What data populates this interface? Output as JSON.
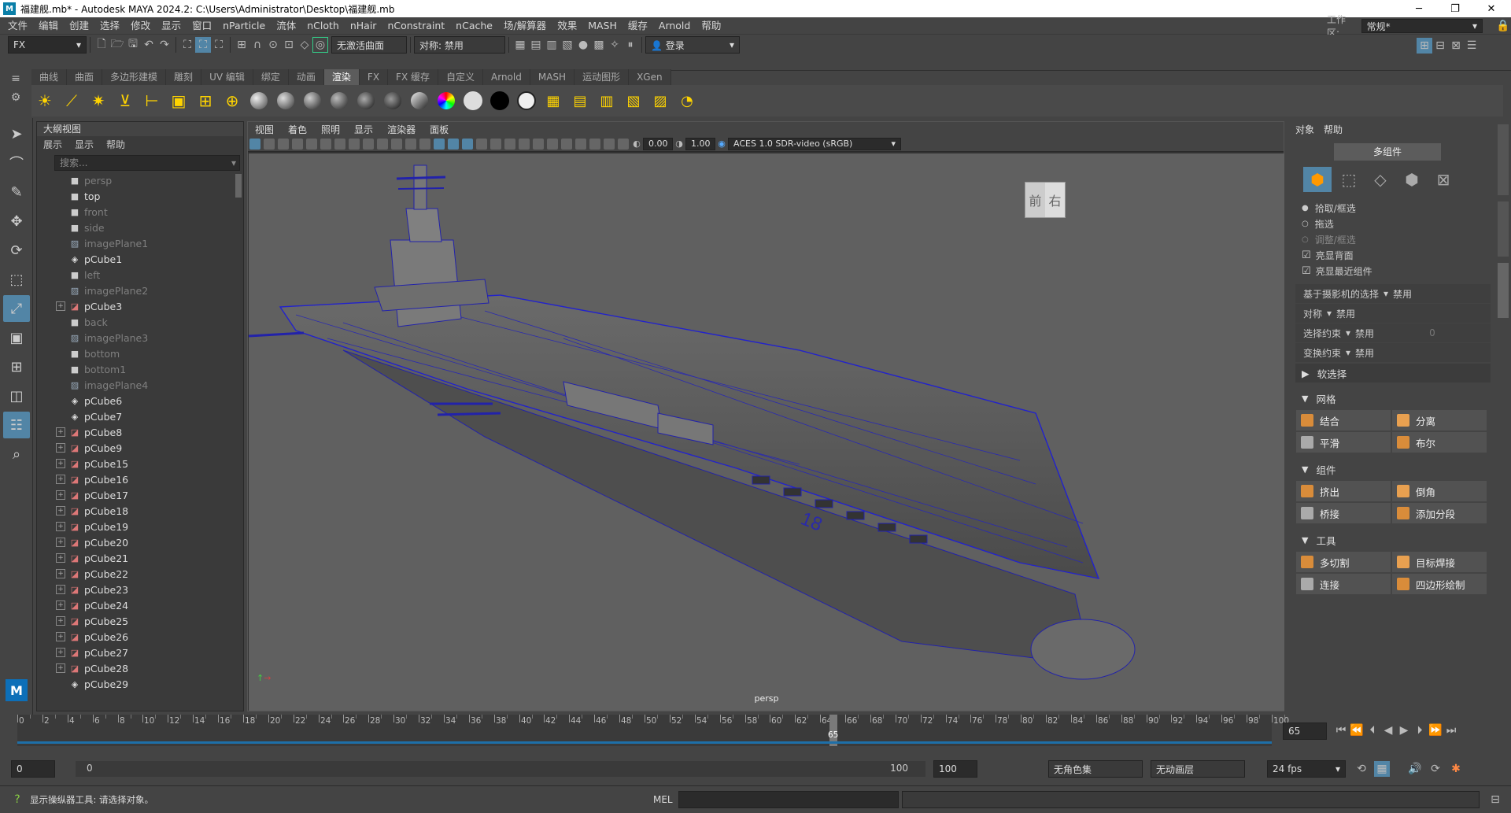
{
  "window": {
    "title": "福建舰.mb* - Autodesk MAYA 2024.2: C:\\Users\\Administrator\\Desktop\\福建舰.mb",
    "logo": "M"
  },
  "menubar": [
    "文件",
    "编辑",
    "创建",
    "选择",
    "修改",
    "显示",
    "窗口",
    "nParticle",
    "流体",
    "nCloth",
    "nHair",
    "nConstraint",
    "nCache",
    "场/解算器",
    "效果",
    "MASH",
    "缓存",
    "Arnold",
    "帮助"
  ],
  "workspace": {
    "label": "工作区:",
    "value": "常规*"
  },
  "statusline": {
    "menuset": "FX",
    "curve_combo": "无激活曲面",
    "symmetry": "对称: 禁用",
    "login": "登录"
  },
  "shelf": {
    "tabs": [
      "曲线",
      "曲面",
      "多边形建模",
      "雕刻",
      "UV 编辑",
      "绑定",
      "动画",
      "渲染",
      "FX",
      "FX 缓存",
      "自定义",
      "Arnold",
      "MASH",
      "运动图形",
      "XGen"
    ],
    "active": "渲染"
  },
  "outliner": {
    "title": "大纲视图",
    "menu": [
      "展示",
      "显示",
      "帮助"
    ],
    "search_placeholder": "搜索...",
    "items": [
      {
        "name": "persp",
        "type": "camera",
        "dim": true,
        "exp": false
      },
      {
        "name": "top",
        "type": "camera",
        "dim": false,
        "exp": false
      },
      {
        "name": "front",
        "type": "camera",
        "dim": true,
        "exp": false
      },
      {
        "name": "side",
        "type": "camera",
        "dim": true,
        "exp": false
      },
      {
        "name": "imagePlane1",
        "type": "image",
        "dim": true,
        "exp": false
      },
      {
        "name": "pCube1",
        "type": "group",
        "dim": false,
        "exp": false
      },
      {
        "name": "left",
        "type": "camera",
        "dim": true,
        "exp": false
      },
      {
        "name": "imagePlane2",
        "type": "image",
        "dim": true,
        "exp": false
      },
      {
        "name": "pCube3",
        "type": "mesh",
        "dim": false,
        "exp": true
      },
      {
        "name": "back",
        "type": "camera",
        "dim": true,
        "exp": false
      },
      {
        "name": "imagePlane3",
        "type": "image",
        "dim": true,
        "exp": false
      },
      {
        "name": "bottom",
        "type": "camera",
        "dim": true,
        "exp": false
      },
      {
        "name": "bottom1",
        "type": "camera",
        "dim": true,
        "exp": false
      },
      {
        "name": "imagePlane4",
        "type": "image",
        "dim": true,
        "exp": false
      },
      {
        "name": "pCube6",
        "type": "group",
        "dim": false,
        "exp": false
      },
      {
        "name": "pCube7",
        "type": "group",
        "dim": false,
        "exp": false
      },
      {
        "name": "pCube8",
        "type": "mesh",
        "dim": false,
        "exp": true
      },
      {
        "name": "pCube9",
        "type": "mesh",
        "dim": false,
        "exp": true
      },
      {
        "name": "pCube15",
        "type": "mesh",
        "dim": false,
        "exp": true
      },
      {
        "name": "pCube16",
        "type": "mesh",
        "dim": false,
        "exp": true
      },
      {
        "name": "pCube17",
        "type": "mesh",
        "dim": false,
        "exp": true
      },
      {
        "name": "pCube18",
        "type": "mesh",
        "dim": false,
        "exp": true
      },
      {
        "name": "pCube19",
        "type": "mesh",
        "dim": false,
        "exp": true
      },
      {
        "name": "pCube20",
        "type": "mesh",
        "dim": false,
        "exp": true
      },
      {
        "name": "pCube21",
        "type": "mesh",
        "dim": false,
        "exp": true
      },
      {
        "name": "pCube22",
        "type": "mesh",
        "dim": false,
        "exp": true
      },
      {
        "name": "pCube23",
        "type": "mesh",
        "dim": false,
        "exp": true
      },
      {
        "name": "pCube24",
        "type": "mesh",
        "dim": false,
        "exp": true
      },
      {
        "name": "pCube25",
        "type": "mesh",
        "dim": false,
        "exp": true
      },
      {
        "name": "pCube26",
        "type": "mesh",
        "dim": false,
        "exp": true
      },
      {
        "name": "pCube27",
        "type": "mesh",
        "dim": false,
        "exp": true
      },
      {
        "name": "pCube28",
        "type": "mesh",
        "dim": false,
        "exp": true
      },
      {
        "name": "pCube29",
        "type": "group",
        "dim": false,
        "exp": false
      }
    ]
  },
  "viewport": {
    "menu": [
      "视图",
      "着色",
      "照明",
      "显示",
      "渲染器",
      "面板"
    ],
    "exposure": "0.00",
    "gamma": "1.00",
    "colorspace": "ACES 1.0 SDR-video (sRGB)",
    "camera_label": "persp",
    "viewcube": {
      "front": "前",
      "right": "右"
    }
  },
  "modeling": {
    "menu": [
      "对象",
      "帮助"
    ],
    "mode_title": "多组件",
    "options": [
      {
        "label": "拾取/框选",
        "kind": "radio",
        "on": true,
        "dim": false
      },
      {
        "label": "拖选",
        "kind": "radio",
        "on": false,
        "dim": false
      },
      {
        "label": "调整/框选",
        "kind": "radio",
        "on": false,
        "dim": true
      },
      {
        "label": "亮显背面",
        "kind": "check",
        "on": true,
        "dim": false
      },
      {
        "label": "亮显最近组件",
        "kind": "check",
        "on": true,
        "dim": false
      }
    ],
    "props": [
      {
        "label": "基于摄影机的选择",
        "value": "禁用",
        "extra": ""
      },
      {
        "label": "对称",
        "value": "禁用",
        "extra": ""
      },
      {
        "label": "选择约束",
        "value": "禁用",
        "extra": "0"
      },
      {
        "label": "变换约束",
        "value": "禁用",
        "extra": ""
      }
    ],
    "soft": "软选择",
    "sections": [
      {
        "title": "网格",
        "buttons": [
          "结合",
          "分离",
          "平滑",
          "布尔"
        ]
      },
      {
        "title": "组件",
        "buttons": [
          "挤出",
          "倒角",
          "桥接",
          "添加分段"
        ]
      },
      {
        "title": "工具",
        "buttons": [
          "多切割",
          "目标焊接",
          "连接",
          "四边形绘制"
        ]
      }
    ]
  },
  "timeline": {
    "labels": [
      "0",
      "2",
      "4",
      "6",
      "8",
      "10",
      "12",
      "14",
      "16",
      "18",
      "20",
      "22",
      "24",
      "26",
      "28",
      "30",
      "32",
      "34",
      "36",
      "38",
      "40",
      "42",
      "44",
      "46",
      "48",
      "50",
      "52",
      "54",
      "56",
      "58",
      "60",
      "62",
      "64",
      "66",
      "68",
      "70",
      "72",
      "74",
      "76",
      "78",
      "80",
      "82",
      "84",
      "86",
      "88",
      "90",
      "92",
      "94",
      "96",
      "98",
      "100"
    ],
    "current": "65",
    "current_field": "65"
  },
  "range": {
    "start": "0",
    "inner_start": "0",
    "inner_end": "100",
    "end": "100",
    "charset": "无角色集",
    "anim_layer": "无动画层",
    "fps": "24 fps"
  },
  "command": {
    "lang": "MEL",
    "status": "显示操纵器工具: 请选择对象。"
  }
}
